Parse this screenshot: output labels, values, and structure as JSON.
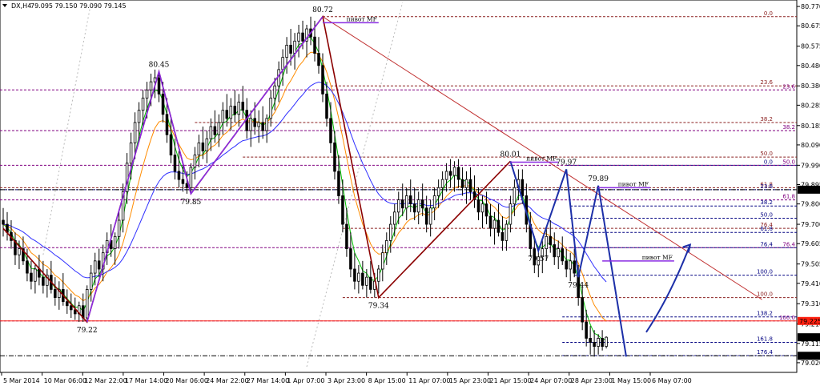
{
  "header": {
    "symbol": "DX,H4",
    "ohlc": "79.095 79.150 79.090 79.145"
  },
  "colors": {
    "candle": "#000000",
    "ma_fast": "#00c000",
    "ma_mid": "#ff8c00",
    "ma_slow": "#3030ff",
    "zigzag": "#8b0000",
    "zigzag_up": "#8a2be2",
    "pattern": "#1c2fa8",
    "fib_lines": "#8b2020",
    "fib_alt": "#800080",
    "current_price_bg": "#000000",
    "alert_bg": "#ff2010",
    "trendline": "#c03030"
  },
  "chart_data": {
    "type": "candlestick",
    "instrument": "DX",
    "timeframe": "H4",
    "x_labels": [
      "5 Mar 2014",
      "10 Mar 06:00",
      "12 Mar 22:00",
      "17 Mar 14:00",
      "20 Mar 06:00",
      "24 Mar 22:00",
      "27 Mar 14:00",
      "1 Apr 07:00",
      "3 Apr 23:00",
      "8 Apr 15:00",
      "11 Apr 07:00",
      "15 Apr 23:00",
      "21 Apr 15:00",
      "24 Apr 07:00",
      "28 Apr 23:00",
      "1 May 15:00",
      "6 May 07:00"
    ],
    "y_ticks": [
      "80.770",
      "80.675",
      "80.575",
      "80.480",
      "80.380",
      "80.285",
      "80.185",
      "80.090",
      "79.990",
      "79.895",
      "79.800",
      "79.700",
      "79.605",
      "79.505",
      "79.410",
      "79.310",
      "79.210",
      "79.115",
      "79.020"
    ],
    "ylim": [
      79.0,
      80.79
    ],
    "price_tags": [
      {
        "label": "79.870",
        "value": 79.87,
        "style": "current"
      },
      {
        "label": "79.225",
        "value": 79.225,
        "style": "alert"
      },
      {
        "label": "79.145",
        "value": 79.145,
        "style": "current"
      },
      {
        "label": "79.054",
        "value": 79.054,
        "style": "current"
      }
    ],
    "pivot_labels": [
      {
        "text": "80.72",
        "x": 80,
        "y": 80.72
      },
      {
        "text": "80.45",
        "x": 39,
        "y": 80.45
      },
      {
        "text": "79.85",
        "x": 47,
        "y": 79.85
      },
      {
        "text": "79.22",
        "x": 21,
        "y": 79.22
      },
      {
        "text": "79.34",
        "x": 94,
        "y": 79.34
      },
      {
        "text": "80.01",
        "x": 127,
        "y": 80.01
      },
      {
        "text": "79.97",
        "x": 141,
        "y": 79.97
      },
      {
        "text": "79.89",
        "x": 149,
        "y": 79.89
      },
      {
        "text": "79.57",
        "x": 134,
        "y": 79.57
      },
      {
        "text": "79.44",
        "x": 144,
        "y": 79.44
      }
    ],
    "mf_labels": [
      "пивот MF",
      "пивот MF",
      "пивот MF",
      "пивот MF"
    ],
    "fib_levels": [
      {
        "label": "0.0",
        "value": 80.72,
        "x1": 80,
        "color": "#8b2020",
        "label_pos": "right"
      },
      {
        "label": "23.6",
        "value": 80.38,
        "x1": 82,
        "color": "#8b2020",
        "label_pos": "right"
      },
      {
        "label": "23.6",
        "value": 80.36,
        "x1": 0,
        "color": "#800080",
        "label_pos": "edge"
      },
      {
        "label": "38.2",
        "value": 80.2,
        "x1": 48,
        "color": "#8b2020",
        "label_pos": "right"
      },
      {
        "label": "38.2",
        "value": 80.16,
        "x1": 0,
        "color": "#800080",
        "label_pos": "edge"
      },
      {
        "label": "50.0",
        "value": 80.03,
        "x1": 60,
        "color": "#8b2020",
        "label_pos": "right"
      },
      {
        "label": "0.0",
        "value": 79.99,
        "x1": 141,
        "color": "#000080",
        "label_pos": "right"
      },
      {
        "label": "50.0",
        "value": 79.99,
        "x1": 0,
        "color": "#800080",
        "label_pos": "edge"
      },
      {
        "label": "61.8",
        "value": 79.88,
        "x1": 0,
        "color": "#8b2020",
        "label_pos": "right"
      },
      {
        "label": "23.6",
        "value": 79.87,
        "x1": 0,
        "color": "#000080",
        "label_pos": "right"
      },
      {
        "label": "61.8",
        "value": 79.82,
        "x1": 0,
        "color": "#800080",
        "label_pos": "edge"
      },
      {
        "label": "38.2",
        "value": 79.79,
        "x1": 142,
        "color": "#000080",
        "label_pos": "right"
      },
      {
        "label": "50.0",
        "value": 79.73,
        "x1": 142,
        "color": "#000080",
        "label_pos": "right"
      },
      {
        "label": "76.4",
        "value": 79.68,
        "x1": 85,
        "color": "#8b2020",
        "label_pos": "right"
      },
      {
        "label": "61.8",
        "value": 79.66,
        "x1": 142,
        "color": "#000080",
        "label_pos": "right"
      },
      {
        "label": "76.4",
        "value": 79.585,
        "x1": 0,
        "color": "#800080",
        "label_pos": "edge"
      },
      {
        "label": "76.4",
        "value": 79.585,
        "x1": 142,
        "color": "#000080",
        "label_pos": "right"
      },
      {
        "label": "100.0",
        "value": 79.45,
        "x1": 143,
        "color": "#000080",
        "label_pos": "right"
      },
      {
        "label": "100.0",
        "value": 79.34,
        "x1": 85,
        "color": "#8b2020",
        "label_pos": "right"
      },
      {
        "label": "138.2",
        "value": 79.245,
        "x1": 140,
        "color": "#000080",
        "label_pos": "right"
      },
      {
        "label": "100.0",
        "value": 79.225,
        "x1": 0,
        "color": "#800080",
        "label_pos": "edge"
      },
      {
        "label": "161.8",
        "value": 79.12,
        "x1": 140,
        "color": "#000080",
        "label_pos": "right"
      },
      {
        "label": "176.4",
        "value": 79.055,
        "x1": 140,
        "color": "#000080",
        "label_pos": "right"
      }
    ],
    "zigzag": [
      {
        "x": 0,
        "y": 79.68
      },
      {
        "x": 21,
        "y": 79.22
      },
      {
        "x": 39,
        "y": 80.45
      },
      {
        "x": 47,
        "y": 79.85
      },
      {
        "x": 80,
        "y": 80.72
      },
      {
        "x": 94,
        "y": 79.34
      },
      {
        "x": 127,
        "y": 80.01
      }
    ],
    "zigzag_up": [
      {
        "x": 21,
        "y": 79.22
      },
      {
        "x": 39,
        "y": 80.45
      },
      {
        "x": 47,
        "y": 79.85
      },
      {
        "x": 80,
        "y": 80.72
      }
    ],
    "pattern": [
      {
        "x": 127,
        "y": 80.01
      },
      {
        "x": 134,
        "y": 79.57
      },
      {
        "x": 141,
        "y": 79.97
      },
      {
        "x": 144,
        "y": 79.44
      },
      {
        "x": 149,
        "y": 79.89
      },
      {
        "x": 156,
        "y": 79.05
      }
    ],
    "pattern_arrow": [
      {
        "x": 161,
        "y": 79.17
      },
      {
        "x": 172,
        "y": 79.6
      }
    ],
    "trendline": [
      {
        "x": 80,
        "y": 80.72
      },
      {
        "x": 190,
        "y": 79.33
      }
    ],
    "mf_segments": [
      {
        "x0": 80,
        "x1": 94,
        "y": 80.69
      },
      {
        "x0": 127,
        "x1": 139,
        "y": 80.005
      },
      {
        "x0": 149,
        "x1": 162,
        "y": 79.88
      },
      {
        "x0": 150,
        "x1": 168,
        "y": 79.52
      }
    ],
    "bar_count": 160,
    "candles": [
      [
        79.72,
        79.78,
        79.64,
        79.7
      ],
      [
        79.7,
        79.76,
        79.62,
        79.66
      ],
      [
        79.66,
        79.72,
        79.58,
        79.62
      ],
      [
        79.62,
        79.66,
        79.5,
        79.55
      ],
      [
        79.55,
        79.62,
        79.48,
        79.58
      ],
      [
        79.58,
        79.64,
        79.5,
        79.52
      ],
      [
        79.52,
        79.58,
        79.42,
        79.46
      ],
      [
        79.46,
        79.52,
        79.38,
        79.42
      ],
      [
        79.42,
        79.5,
        79.36,
        79.48
      ],
      [
        79.48,
        79.55,
        79.4,
        79.44
      ],
      [
        79.44,
        79.52,
        79.36,
        79.4
      ],
      [
        79.4,
        79.48,
        79.34,
        79.45
      ],
      [
        79.45,
        79.52,
        79.36,
        79.38
      ],
      [
        79.38,
        79.44,
        79.3,
        79.34
      ],
      [
        79.34,
        79.42,
        79.28,
        79.38
      ],
      [
        79.38,
        79.46,
        79.3,
        79.32
      ],
      [
        79.32,
        79.38,
        79.26,
        79.3
      ],
      [
        79.3,
        79.36,
        79.24,
        79.28
      ],
      [
        79.28,
        79.34,
        79.23,
        79.26
      ],
      [
        79.26,
        79.32,
        79.22,
        79.3
      ],
      [
        79.3,
        79.36,
        79.22,
        79.24
      ],
      [
        79.24,
        79.4,
        79.22,
        79.38
      ],
      [
        79.38,
        79.5,
        79.32,
        79.46
      ],
      [
        79.46,
        79.56,
        79.4,
        79.52
      ],
      [
        79.52,
        79.58,
        79.44,
        79.48
      ],
      [
        79.48,
        79.6,
        79.42,
        79.56
      ],
      [
        79.56,
        79.66,
        79.5,
        79.62
      ],
      [
        79.62,
        79.7,
        79.54,
        79.58
      ],
      [
        79.58,
        79.66,
        79.5,
        79.64
      ],
      [
        79.64,
        79.76,
        79.58,
        79.72
      ],
      [
        79.72,
        79.9,
        79.66,
        79.86
      ],
      [
        79.86,
        80.05,
        79.8,
        80.0
      ],
      [
        80.0,
        80.15,
        79.92,
        80.1
      ],
      [
        80.1,
        80.25,
        80.02,
        80.2
      ],
      [
        80.2,
        80.3,
        80.12,
        80.26
      ],
      [
        80.26,
        80.36,
        80.18,
        80.32
      ],
      [
        80.32,
        80.4,
        80.22,
        80.36
      ],
      [
        80.36,
        80.44,
        80.28,
        80.4
      ],
      [
        80.4,
        80.46,
        80.32,
        80.42
      ],
      [
        80.42,
        80.45,
        80.3,
        80.34
      ],
      [
        80.34,
        80.4,
        80.2,
        80.24
      ],
      [
        80.24,
        80.32,
        80.1,
        80.14
      ],
      [
        80.14,
        80.22,
        80.0,
        80.04
      ],
      [
        80.04,
        80.12,
        79.92,
        79.96
      ],
      [
        79.96,
        80.06,
        79.88,
        79.92
      ],
      [
        79.92,
        80.0,
        79.86,
        79.9
      ],
      [
        79.9,
        79.96,
        79.85,
        79.88
      ],
      [
        79.88,
        80.0,
        79.85,
        79.98
      ],
      [
        79.98,
        80.08,
        79.92,
        80.04
      ],
      [
        80.04,
        80.14,
        79.98,
        80.1
      ],
      [
        80.1,
        80.18,
        80.02,
        80.06
      ],
      [
        80.06,
        80.16,
        80.0,
        80.12
      ],
      [
        80.12,
        80.22,
        80.06,
        80.18
      ],
      [
        80.18,
        80.26,
        80.1,
        80.14
      ],
      [
        80.14,
        80.24,
        80.08,
        80.2
      ],
      [
        80.2,
        80.3,
        80.14,
        80.26
      ],
      [
        80.26,
        80.34,
        80.18,
        80.22
      ],
      [
        80.22,
        80.32,
        80.16,
        80.28
      ],
      [
        80.28,
        80.36,
        80.2,
        80.24
      ],
      [
        80.24,
        80.34,
        80.18,
        80.3
      ],
      [
        80.3,
        80.38,
        80.22,
        80.26
      ],
      [
        80.26,
        80.32,
        80.12,
        80.16
      ],
      [
        80.16,
        80.26,
        80.08,
        80.22
      ],
      [
        80.22,
        80.3,
        80.14,
        80.18
      ],
      [
        80.18,
        80.26,
        80.1,
        80.2
      ],
      [
        80.2,
        80.28,
        80.12,
        80.16
      ],
      [
        80.16,
        80.24,
        80.1,
        80.22
      ],
      [
        80.22,
        80.36,
        80.18,
        80.32
      ],
      [
        80.32,
        80.42,
        80.26,
        80.38
      ],
      [
        80.38,
        80.5,
        80.3,
        80.46
      ],
      [
        80.46,
        80.56,
        80.38,
        80.52
      ],
      [
        80.52,
        80.62,
        80.44,
        80.58
      ],
      [
        80.58,
        80.66,
        80.48,
        80.54
      ],
      [
        80.54,
        80.64,
        80.46,
        80.6
      ],
      [
        80.6,
        80.68,
        80.52,
        80.64
      ],
      [
        80.64,
        80.7,
        80.56,
        80.6
      ],
      [
        80.6,
        80.68,
        80.52,
        80.66
      ],
      [
        80.66,
        80.72,
        80.58,
        80.62
      ],
      [
        80.62,
        80.7,
        80.5,
        80.54
      ],
      [
        80.54,
        80.62,
        80.44,
        80.48
      ],
      [
        80.48,
        80.54,
        80.3,
        80.34
      ],
      [
        80.34,
        80.4,
        80.18,
        80.22
      ],
      [
        80.22,
        80.3,
        80.05,
        80.1
      ],
      [
        80.1,
        80.16,
        79.92,
        79.96
      ],
      [
        79.96,
        80.04,
        79.8,
        79.84
      ],
      [
        79.84,
        79.92,
        79.66,
        79.7
      ],
      [
        79.7,
        79.78,
        79.54,
        79.58
      ],
      [
        79.58,
        79.66,
        79.44,
        79.48
      ],
      [
        79.48,
        79.56,
        79.38,
        79.42
      ],
      [
        79.42,
        79.5,
        79.36,
        79.46
      ],
      [
        79.46,
        79.52,
        79.38,
        79.4
      ],
      [
        79.4,
        79.48,
        79.34,
        79.44
      ],
      [
        79.44,
        79.52,
        79.36,
        79.38
      ],
      [
        79.38,
        79.46,
        79.34,
        79.42
      ],
      [
        79.42,
        79.5,
        79.36,
        79.48
      ],
      [
        79.48,
        79.6,
        79.42,
        79.56
      ],
      [
        79.56,
        79.66,
        79.5,
        79.62
      ],
      [
        79.62,
        79.74,
        79.56,
        79.7
      ],
      [
        79.7,
        79.8,
        79.64,
        79.76
      ],
      [
        79.76,
        79.86,
        79.7,
        79.82
      ],
      [
        79.82,
        79.9,
        79.74,
        79.78
      ],
      [
        79.78,
        79.88,
        79.72,
        79.84
      ],
      [
        79.84,
        79.92,
        79.76,
        79.8
      ],
      [
        79.8,
        79.88,
        79.72,
        79.76
      ],
      [
        79.76,
        79.86,
        79.7,
        79.82
      ],
      [
        79.82,
        79.9,
        79.74,
        79.78
      ],
      [
        79.78,
        79.84,
        79.66,
        79.7
      ],
      [
        79.7,
        79.82,
        79.64,
        79.78
      ],
      [
        79.78,
        79.88,
        79.72,
        79.84
      ],
      [
        79.84,
        79.92,
        79.78,
        79.88
      ],
      [
        79.88,
        79.96,
        79.82,
        79.92
      ],
      [
        79.92,
        80.0,
        79.86,
        79.96
      ],
      [
        79.96,
        80.02,
        79.88,
        79.94
      ],
      [
        79.94,
        80.01,
        79.86,
        79.98
      ],
      [
        79.98,
        80.02,
        79.88,
        79.92
      ],
      [
        79.92,
        79.98,
        79.84,
        79.88
      ],
      [
        79.88,
        79.96,
        79.8,
        79.92
      ],
      [
        79.92,
        79.98,
        79.82,
        79.86
      ],
      [
        79.86,
        79.94,
        79.78,
        79.82
      ],
      [
        79.82,
        79.88,
        79.72,
        79.76
      ],
      [
        79.76,
        79.84,
        79.68,
        79.8
      ],
      [
        79.8,
        79.86,
        79.7,
        79.74
      ],
      [
        79.74,
        79.8,
        79.64,
        79.68
      ],
      [
        79.68,
        79.76,
        79.6,
        79.72
      ],
      [
        79.72,
        79.8,
        79.64,
        79.66
      ],
      [
        79.66,
        79.74,
        79.57,
        79.62
      ],
      [
        79.62,
        79.72,
        79.57,
        79.7
      ],
      [
        79.7,
        79.84,
        79.66,
        79.8
      ],
      [
        79.8,
        79.92,
        79.74,
        79.88
      ],
      [
        79.88,
        79.97,
        79.82,
        79.92
      ],
      [
        79.92,
        79.97,
        79.8,
        79.84
      ],
      [
        79.84,
        79.9,
        79.66,
        79.7
      ],
      [
        79.7,
        79.76,
        79.54,
        79.58
      ],
      [
        79.58,
        79.64,
        79.46,
        79.5
      ],
      [
        79.5,
        79.58,
        79.44,
        79.54
      ],
      [
        79.54,
        79.62,
        79.46,
        79.58
      ],
      [
        79.58,
        79.68,
        79.52,
        79.64
      ],
      [
        79.64,
        79.72,
        79.56,
        79.6
      ],
      [
        79.6,
        79.66,
        79.5,
        79.54
      ],
      [
        79.54,
        79.62,
        79.48,
        79.58
      ],
      [
        79.58,
        79.64,
        79.5,
        79.52
      ],
      [
        79.52,
        79.58,
        79.44,
        79.48
      ],
      [
        79.48,
        79.56,
        79.42,
        79.52
      ],
      [
        79.52,
        79.58,
        79.44,
        79.46
      ],
      [
        79.46,
        79.5,
        79.3,
        79.34
      ],
      [
        79.34,
        79.4,
        79.18,
        79.22
      ],
      [
        79.22,
        79.28,
        79.1,
        79.14
      ],
      [
        79.14,
        79.2,
        79.06,
        79.12
      ],
      [
        79.12,
        79.18,
        79.05,
        79.1
      ],
      [
        79.1,
        79.16,
        79.06,
        79.14
      ],
      [
        79.14,
        79.18,
        79.08,
        79.1
      ],
      [
        79.1,
        79.15,
        79.09,
        79.145
      ]
    ]
  }
}
